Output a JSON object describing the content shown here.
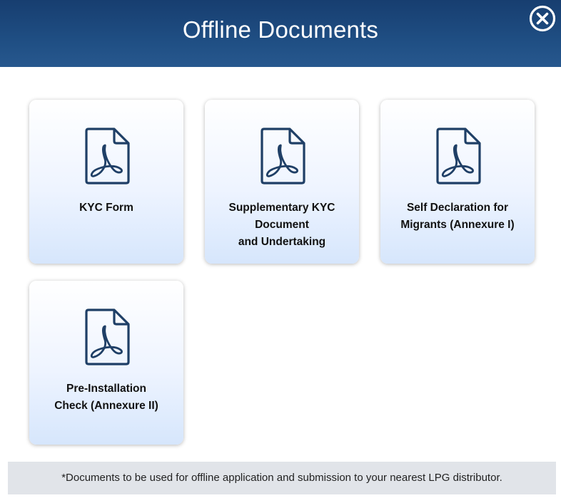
{
  "modal": {
    "title": "Offline Documents",
    "close_icon": "close-circle-icon"
  },
  "documents": [
    {
      "icon": "pdf-file-icon",
      "line1": "KYC Form",
      "line2": "",
      "line3": ""
    },
    {
      "icon": "pdf-file-icon",
      "line1": "Supplementary KYC",
      "line2": "Document",
      "line3": "and Undertaking"
    },
    {
      "icon": "pdf-file-icon",
      "line1": "Self Declaration for",
      "line2": "Migrants (Annexure I)",
      "line3": ""
    },
    {
      "icon": "pdf-file-icon",
      "line1": "Pre-Installation",
      "line2": "Check (Annexure II)",
      "line3": ""
    }
  ],
  "footer": {
    "note": "*Documents to be used for offline application and submission to your nearest LPG distributor."
  },
  "colors": {
    "header": "#1f4e83",
    "icon_stroke": "#1f3f66",
    "footer_bg": "#e1e4e9"
  }
}
